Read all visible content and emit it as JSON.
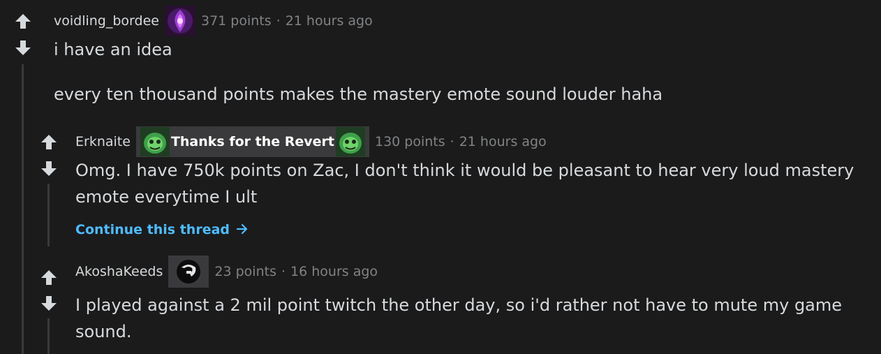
{
  "comments": [
    {
      "author": "voidling_bordee",
      "flair_icon": "void-champion-icon",
      "points": "371 points",
      "separator": "·",
      "time": "21 hours ago",
      "paragraphs": [
        "i have an idea",
        "every ten thousand points makes the mastery emote sound louder haha"
      ]
    },
    {
      "author": "Erknaite",
      "flair_icon": "zac-icon",
      "flair_text": "Thanks for the Revert",
      "points": "130 points",
      "separator": "·",
      "time": "21 hours ago",
      "paragraphs": [
        "Omg. I have 750k points on Zac, I don't think it would be pleasant to hear very loud mastery emote everytime I ult"
      ],
      "continue_label": "Continue this thread"
    },
    {
      "author": "AkoshaKeeds",
      "flair_icon": "team-logo-icon",
      "points": "23 points",
      "separator": "·",
      "time": "16 hours ago",
      "paragraphs": [
        "I played against a 2 mil point twitch the other day, so i'd rather not have to mute my game sound."
      ]
    }
  ],
  "colors": {
    "background": "#1b1b1c",
    "text": "#d7dadc",
    "muted": "#818384",
    "link": "#4fbcff",
    "thread_line": "#3a3a3c",
    "flair_bg": "#3a3a3c"
  }
}
